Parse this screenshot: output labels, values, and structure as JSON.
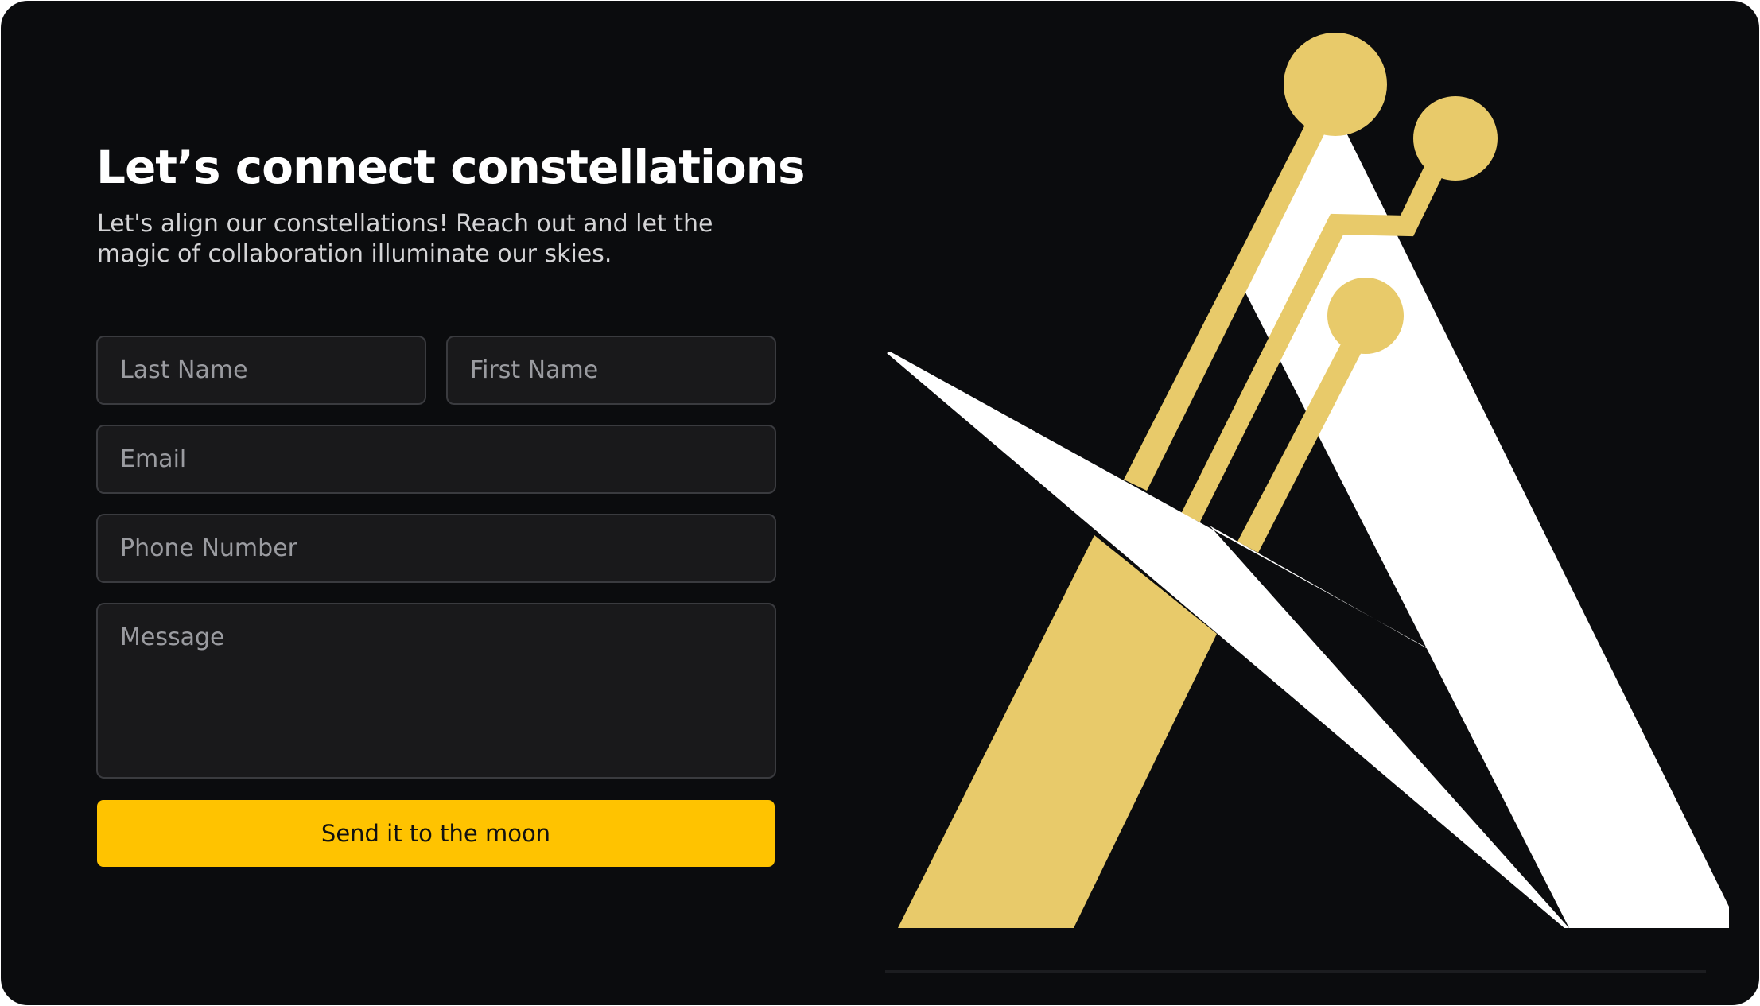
{
  "form": {
    "heading": "Let’s connect constellations",
    "subtitle": "Let's align our constellations! Reach out and let the magic of collaboration illuminate our skies.",
    "fields": {
      "last_name": {
        "placeholder": "Last Name",
        "value": ""
      },
      "first_name": {
        "placeholder": "First Name",
        "value": ""
      },
      "email": {
        "placeholder": "Email",
        "value": ""
      },
      "phone": {
        "placeholder": "Phone Number",
        "value": ""
      },
      "message": {
        "placeholder": "Message",
        "value": ""
      }
    },
    "submit_label": "Send it to the moon"
  },
  "colors": {
    "background": "#0b0c0e",
    "accent": "#ffc300",
    "logo_gold": "#e8ca6a",
    "logo_white": "#ffffff"
  },
  "illustration": {
    "icon": "constellation-logo-icon"
  }
}
